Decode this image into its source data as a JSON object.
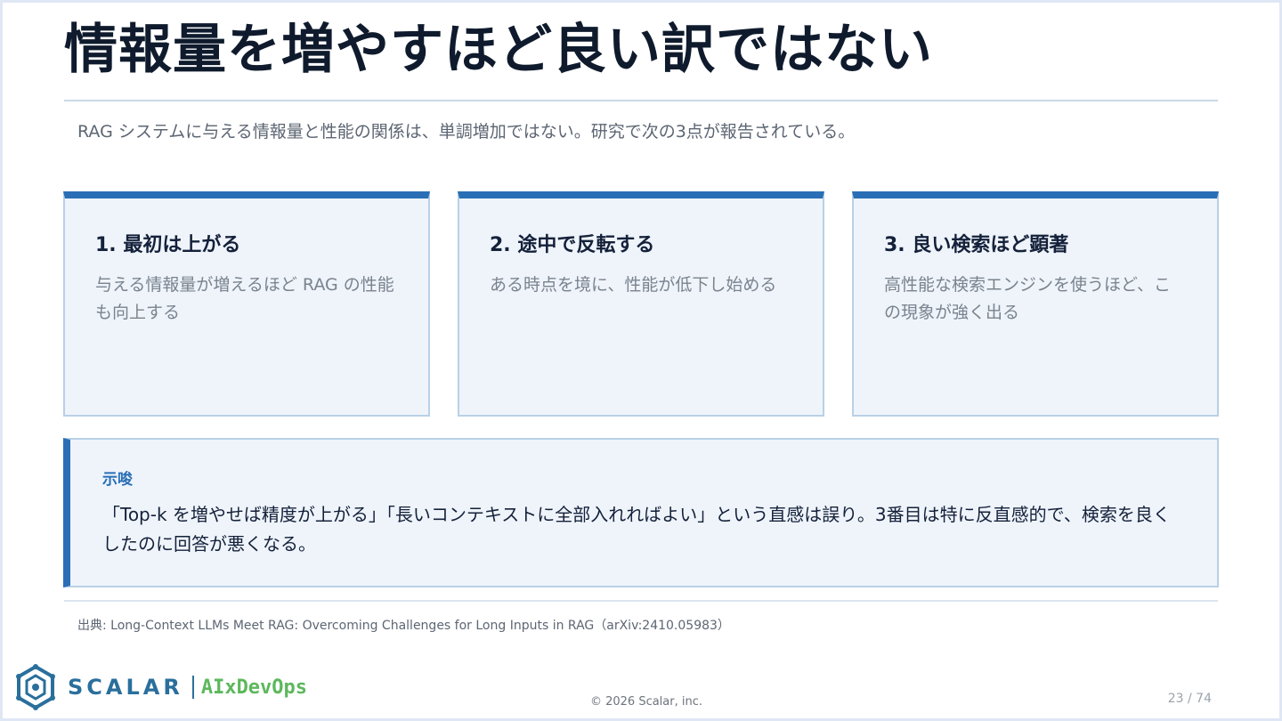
{
  "title": "情報量を増やすほど良い訳ではない",
  "lead": "RAG システムに与える情報量と性能の関係は、単調増加ではない。研究で次の3点が報告されている。",
  "cards": [
    {
      "title": "1. 最初は上がる",
      "body": "与える情報量が増えるほど RAG の性能も向上する"
    },
    {
      "title": "2. 途中で反転する",
      "body": "ある時点を境に、性能が低下し始める"
    },
    {
      "title": "3. 良い検索ほど顕著",
      "body": "高性能な検索エンジンを使うほど、この現象が強く出る"
    }
  ],
  "insight": {
    "label": "示唆",
    "body": "「Top-k を増やせば精度が上がる」「長いコンテキストに全部入れればよい」という直感は誤り。3番目は特に反直感的で、検索を良くしたのに回答が悪くなる。"
  },
  "source": "出典: Long-Context LLMs Meet RAG: Overcoming Challenges for Long Inputs in RAG（arXiv:2410.05983）",
  "footer": {
    "brand": "SCALAR",
    "brand_sub": "AIxDevOps",
    "copyright": "© 2026 Scalar, inc.",
    "page": "23 / 74"
  },
  "colors": {
    "accent": "#2a6fb5",
    "card_bg": "#eff4fb",
    "card_border": "#b9d0e6",
    "brand": "#2a6f9c",
    "brand_sub": "#5cb85c"
  },
  "icons": {
    "logo": "scalar-logo-icon"
  }
}
